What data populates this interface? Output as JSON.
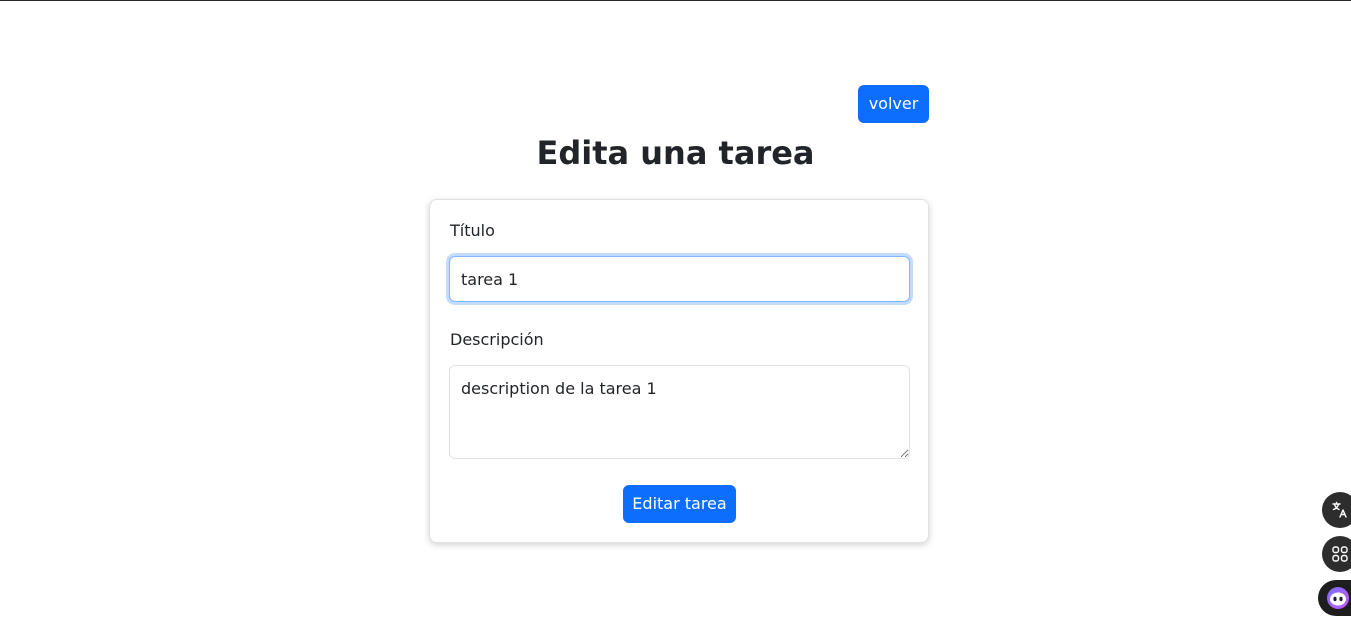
{
  "header": {
    "back_label": "volver",
    "title": "Edita una tarea"
  },
  "form": {
    "title_label": "Título",
    "title_value": "tarea 1",
    "description_label": "Descripción",
    "description_value": "description de la tarea 1",
    "submit_label": "Editar tarea"
  },
  "floating_toolbar": {
    "icons": [
      "translate-icon",
      "apps-grid-icon",
      "assistant-icon"
    ]
  },
  "colors": {
    "primary": "#0d6efd",
    "text": "#212529",
    "focus_border": "#86b7fe",
    "floating_bg": "#2d2d2d"
  }
}
